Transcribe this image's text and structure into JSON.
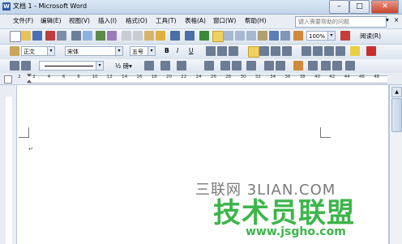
{
  "window": {
    "title": "文档 1 - Microsoft Word",
    "minimize": "–",
    "maximize": "□",
    "close": "✕"
  },
  "menu": {
    "items": [
      "文件(F)",
      "编辑(E)",
      "视图(V)",
      "插入(I)",
      "格式(O)",
      "工具(T)",
      "表格(A)",
      "窗口(W)",
      "帮助(H)"
    ],
    "help_placeholder": "键入需要帮助的问题",
    "help_arrow": "▾",
    "close_x": "×"
  },
  "standard_toolbar": {
    "zoom": "100%",
    "read": "阅读(R)"
  },
  "format_toolbar": {
    "style": "正文",
    "font": "宋体",
    "size": "五号",
    "bold": "B",
    "italic": "I",
    "underline": "U"
  },
  "drawing_toolbar": {
    "ratio": "½ 磅▾"
  },
  "ruler": {
    "ticks": [
      "2",
      "2",
      "4",
      "6",
      "8",
      "10",
      "12",
      "14",
      "16",
      "18",
      "20",
      "22",
      "24",
      "26",
      "28",
      "30",
      "32",
      "34",
      "36",
      "38",
      "40",
      "42",
      "44",
      "46",
      "48"
    ]
  },
  "document": {
    "cursor_mark": "↵"
  },
  "watermark": {
    "line1": "三联网 3LIAN.COM",
    "line2": "技术员联盟",
    "line3": "www.jsgho.com"
  },
  "colors": {
    "accent": "#2b5cae",
    "watermark_green": "#3cb54a"
  }
}
